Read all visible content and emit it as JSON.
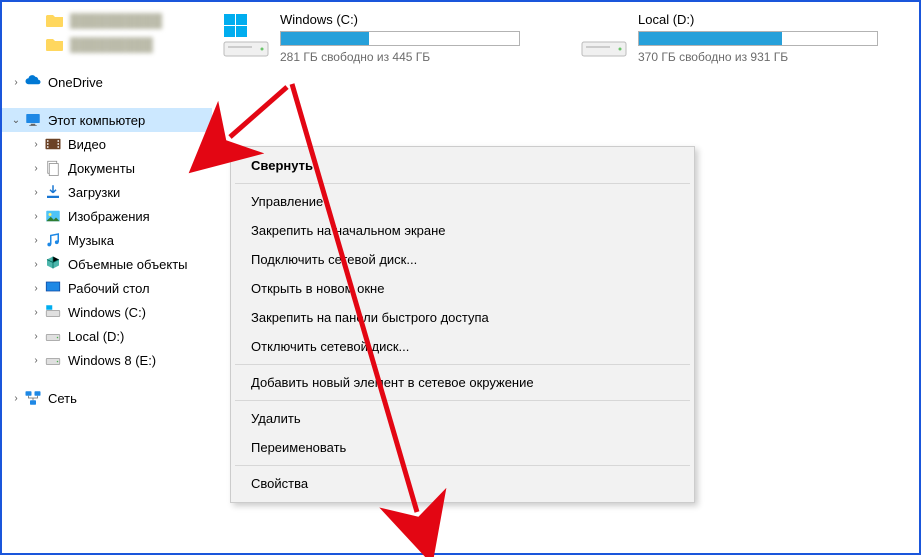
{
  "sidebar": {
    "topBlurred": [
      "██████████",
      "█████████"
    ],
    "items": [
      {
        "label": "OneDrive",
        "icon": "onedrive",
        "expander": "›"
      },
      {
        "label": "Этот компьютер",
        "icon": "thispc",
        "expander": "⌄",
        "selected": true
      },
      {
        "label": "Видео",
        "icon": "video",
        "expander": "›",
        "indent": 1
      },
      {
        "label": "Документы",
        "icon": "documents",
        "expander": "›",
        "indent": 1
      },
      {
        "label": "Загрузки",
        "icon": "downloads",
        "expander": "›",
        "indent": 1
      },
      {
        "label": "Изображения",
        "icon": "pictures",
        "expander": "›",
        "indent": 1
      },
      {
        "label": "Музыка",
        "icon": "music",
        "expander": "›",
        "indent": 1
      },
      {
        "label": "Объемные объекты",
        "icon": "3dobjects",
        "expander": "›",
        "indent": 1
      },
      {
        "label": "Рабочий стол",
        "icon": "desktop",
        "expander": "›",
        "indent": 1
      },
      {
        "label": "Windows (C:)",
        "icon": "drive-win",
        "expander": "›",
        "indent": 1
      },
      {
        "label": "Local (D:)",
        "icon": "drive",
        "expander": "›",
        "indent": 1
      },
      {
        "label": "Windows 8 (E:)",
        "icon": "drive",
        "expander": "›",
        "indent": 1
      },
      {
        "label": "Сеть",
        "icon": "network",
        "expander": "›"
      }
    ]
  },
  "drives": [
    {
      "name": "Windows (C:)",
      "free_text": "281 ГБ свободно из 445 ГБ",
      "used_pct": 37,
      "windows": true
    },
    {
      "name": "Local (D:)",
      "free_text": "370 ГБ свободно из 931 ГБ",
      "used_pct": 60,
      "windows": false
    }
  ],
  "context_menu": {
    "groups": [
      [
        {
          "label": "Свернуть",
          "bold": true
        }
      ],
      [
        {
          "label": "Управление"
        },
        {
          "label": "Закрепить на начальном экране"
        },
        {
          "label": "Подключить сетевой диск..."
        },
        {
          "label": "Открыть в новом окне"
        },
        {
          "label": "Закрепить на панели быстрого доступа"
        },
        {
          "label": "Отключить сетевой диск..."
        }
      ],
      [
        {
          "label": "Добавить новый элемент в сетевое окружение"
        }
      ],
      [
        {
          "label": "Удалить"
        },
        {
          "label": "Переименовать"
        }
      ],
      [
        {
          "label": "Свойства"
        }
      ]
    ]
  },
  "colors": {
    "accent": "#26a0da",
    "arrow": "#e30613"
  }
}
